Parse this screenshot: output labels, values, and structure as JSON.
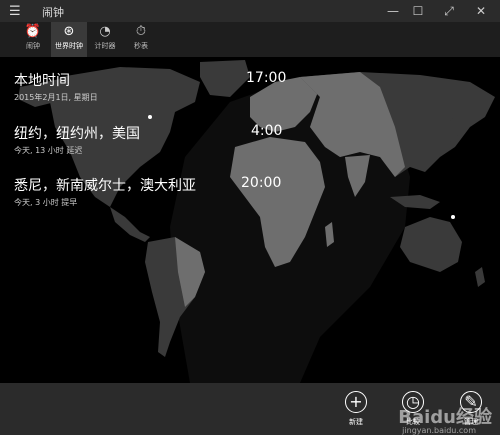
{
  "window": {
    "title": "闹钟",
    "menu_icon": "hamburger-icon",
    "minimize": "—",
    "maximize": "☐",
    "fullscreen": "⤢",
    "close": "✕"
  },
  "tabs": [
    {
      "label": "闹钟",
      "icon": "alarm-icon",
      "glyph": "⏰"
    },
    {
      "label": "世界时钟",
      "icon": "world-clock-icon",
      "glyph": "⊛",
      "active": true
    },
    {
      "label": "计时器",
      "icon": "timer-icon",
      "glyph": "◔"
    },
    {
      "label": "秒表",
      "icon": "stopwatch-icon",
      "glyph": "⏱"
    }
  ],
  "cities": [
    {
      "name": "本地时间",
      "detail": "2015年2月1日, 星期日",
      "time": "17:00"
    },
    {
      "name": "纽约，纽约州，美国",
      "detail": "今天, 13 小时 延迟",
      "time": "4:00"
    },
    {
      "name": "悉尼，新南威尔士，澳大利亚",
      "detail": "今天, 3 小时 提早",
      "time": "20:00"
    }
  ],
  "actions": [
    {
      "label": "新建",
      "icon": "plus-icon",
      "glyph": "+"
    },
    {
      "label": "比较",
      "icon": "compare-icon",
      "glyph": "◷"
    },
    {
      "label": "管理",
      "icon": "edit-icon",
      "glyph": "✎"
    }
  ],
  "watermark": {
    "text": "Baidu经验",
    "sub": "jingyan.baidu.com"
  },
  "colors": {
    "titlebar": "#2b2b2b",
    "tabbar": "#1e1e1e",
    "land_day": "#6e6e6e",
    "land_night": "#3a3a3a",
    "background": "#000000"
  }
}
